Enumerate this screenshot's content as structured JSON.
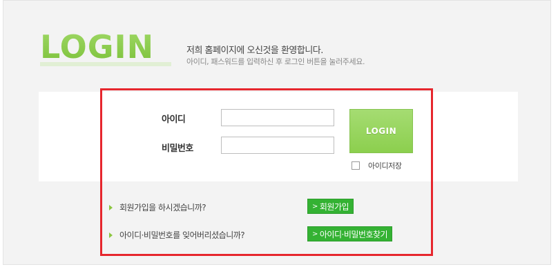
{
  "header": {
    "logo_text": "LOGIN",
    "welcome": "저희 홈페이지에 오신것을 환영합니다.",
    "instruction": "아이디, 패스워드를 입력하신 후 로그인 버튼을 눌러주세요."
  },
  "form": {
    "id_label": "아이디",
    "id_value": "",
    "password_label": "비밀번호",
    "password_value": "",
    "login_button": "LOGIN",
    "save_id_label": "아이디저장",
    "save_id_checked": false
  },
  "links": {
    "signup_question": "회원가입을 하시겠습니까?",
    "signup_button": "회원가입",
    "forgot_question": "아이디·비밀번호를 잊어버리셨습니까?",
    "forgot_button": "아이디·비밀번호찾기",
    "chevron": ">"
  },
  "colors": {
    "accent_green": "#8cd24f",
    "button_green": "#34b233",
    "highlight_red": "#e6262d",
    "panel_bg": "#f3f3f3"
  }
}
